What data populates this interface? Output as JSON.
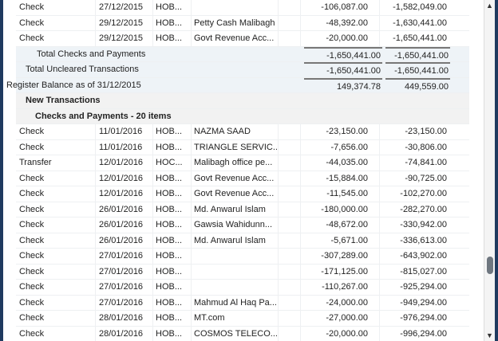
{
  "prior_rows": [
    {
      "type": "Check",
      "date": "27/12/2015",
      "account": "HOB...",
      "name": "",
      "amount": "-106,087.00",
      "balance": "-1,582,049.00"
    },
    {
      "type": "Check",
      "date": "29/12/2015",
      "account": "HOB...",
      "name": "Petty Cash Malibagh",
      "amount": "-48,392.00",
      "balance": "-1,630,441.00"
    },
    {
      "type": "Check",
      "date": "29/12/2015",
      "account": "HOB...",
      "name": "Govt Revenue Acc...",
      "amount": "-20,000.00",
      "balance": "-1,650,441.00"
    }
  ],
  "totals": {
    "checks_label": "Total Checks and Payments",
    "checks_amount": "-1,650,441.00",
    "checks_balance": "-1,650,441.00",
    "uncleared_label": "Total Uncleared Transactions",
    "uncleared_amount": "-1,650,441.00",
    "uncleared_balance": "-1,650,441.00",
    "register_label": "Register Balance as of 31/12/2015",
    "register_amount": "149,374.78",
    "register_balance": "449,559.00"
  },
  "groups": {
    "new_transactions": "New Transactions",
    "checks_payments": "Checks and Payments - 20 items"
  },
  "rows": [
    {
      "type": "Check",
      "date": "11/01/2016",
      "account": "HOB...",
      "name": "NAZMA SAAD",
      "amount": "-23,150.00",
      "balance": "-23,150.00"
    },
    {
      "type": "Check",
      "date": "11/01/2016",
      "account": "HOB...",
      "name": "TRIANGLE SERVIC...",
      "amount": "-7,656.00",
      "balance": "-30,806.00"
    },
    {
      "type": "Transfer",
      "date": "12/01/2016",
      "account": "HOC...",
      "name": "Malibagh office pe...",
      "amount": "-44,035.00",
      "balance": "-74,841.00"
    },
    {
      "type": "Check",
      "date": "12/01/2016",
      "account": "HOB...",
      "name": "Govt Revenue Acc...",
      "amount": "-15,884.00",
      "balance": "-90,725.00"
    },
    {
      "type": "Check",
      "date": "12/01/2016",
      "account": "HOB...",
      "name": "Govt Revenue Acc...",
      "amount": "-11,545.00",
      "balance": "-102,270.00"
    },
    {
      "type": "Check",
      "date": "26/01/2016",
      "account": "HOB...",
      "name": "Md. Anwarul Islam",
      "amount": "-180,000.00",
      "balance": "-282,270.00"
    },
    {
      "type": "Check",
      "date": "26/01/2016",
      "account": "HOB...",
      "name": "Gawsia Wahidunn...",
      "amount": "-48,672.00",
      "balance": "-330,942.00"
    },
    {
      "type": "Check",
      "date": "26/01/2016",
      "account": "HOB...",
      "name": "Md. Anwarul Islam",
      "amount": "-5,671.00",
      "balance": "-336,613.00"
    },
    {
      "type": "Check",
      "date": "27/01/2016",
      "account": "HOB...",
      "name": "",
      "amount": "-307,289.00",
      "balance": "-643,902.00"
    },
    {
      "type": "Check",
      "date": "27/01/2016",
      "account": "HOB...",
      "name": "",
      "amount": "-171,125.00",
      "balance": "-815,027.00"
    },
    {
      "type": "Check",
      "date": "27/01/2016",
      "account": "HOB...",
      "name": "",
      "amount": "-110,267.00",
      "balance": "-925,294.00"
    },
    {
      "type": "Check",
      "date": "27/01/2016",
      "account": "HOB...",
      "name": "Mahmud Al Haq Pa...",
      "amount": "-24,000.00",
      "balance": "-949,294.00"
    },
    {
      "type": "Check",
      "date": "28/01/2016",
      "account": "HOB...",
      "name": "MT.com",
      "amount": "-27,000.00",
      "balance": "-976,294.00"
    },
    {
      "type": "Check",
      "date": "28/01/2016",
      "account": "HOB...",
      "name": "COSMOS TELECO...",
      "amount": "-20,000.00",
      "balance": "-996,294.00"
    }
  ]
}
